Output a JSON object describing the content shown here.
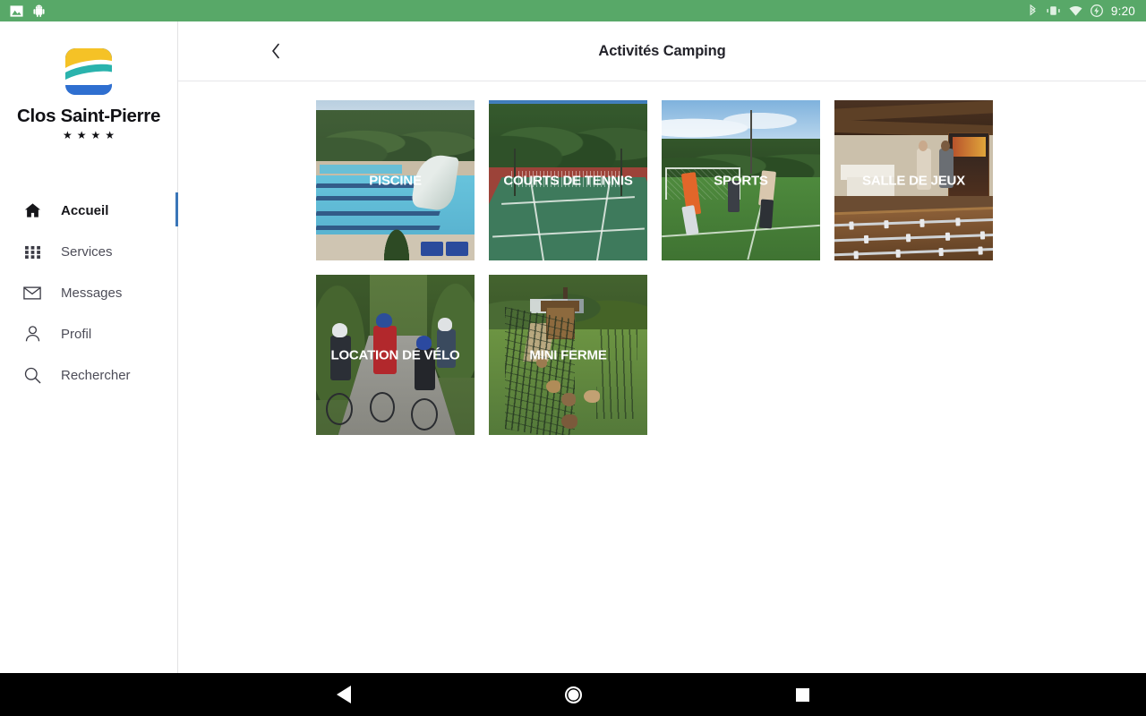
{
  "statusbar": {
    "time": "9:20",
    "left_icons": [
      "photo-icon",
      "android-robot-icon"
    ],
    "right_icons": [
      "bluetooth-icon",
      "vibrate-icon",
      "wifi-icon",
      "battery-charging-icon"
    ],
    "background_color": "#58a868"
  },
  "sidebar": {
    "brand": {
      "name": "Clos Saint-Pierre",
      "stars": [
        "star",
        "star",
        "star",
        "star"
      ],
      "logo_colors": {
        "top": "#f5c226",
        "wave": "#2ab3ad",
        "bottom": "#2f6fd0"
      }
    },
    "items": [
      {
        "label": "Accueil",
        "icon": "home-icon",
        "active": true
      },
      {
        "label": "Services",
        "icon": "grid-icon",
        "active": false
      },
      {
        "label": "Messages",
        "icon": "envelope-icon",
        "active": false
      },
      {
        "label": "Profil",
        "icon": "user-icon",
        "active": false
      },
      {
        "label": "Rechercher",
        "icon": "search-icon",
        "active": false
      }
    ],
    "active_indicator_color": "#3a76b8"
  },
  "header": {
    "back_icon": "chevron-left-icon",
    "title": "Activités Camping"
  },
  "activities": [
    {
      "label": "PISCINE",
      "scene": "c-pool"
    },
    {
      "label": "COURTS DE TENNIS",
      "scene": "c-tennis"
    },
    {
      "label": "SPORTS",
      "scene": "c-sports"
    },
    {
      "label": "SALLE DE JEUX",
      "scene": "c-games"
    },
    {
      "label": "LOCATION DE VÉLO",
      "scene": "c-bike"
    },
    {
      "label": "MINI FERME",
      "scene": "c-farm"
    }
  ],
  "navbar": {
    "back_label": "back-triangle",
    "home_label": "home-circle",
    "recents_label": "recents-square"
  }
}
